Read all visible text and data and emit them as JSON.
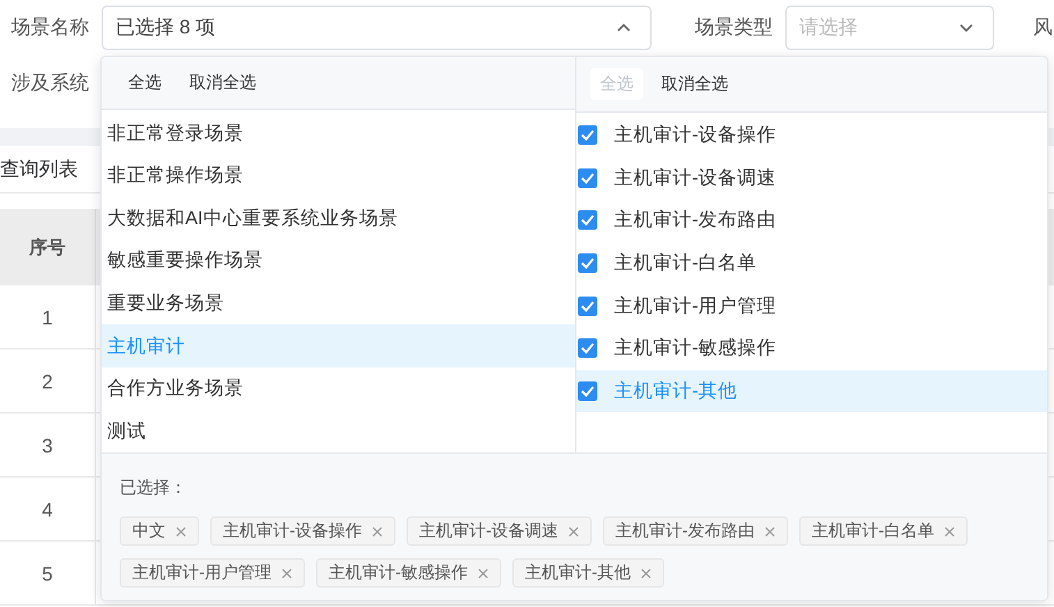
{
  "filters": [
    {
      "label": "场景名称",
      "value": "已选择 8 项",
      "expanded": true
    },
    {
      "label": "场景类型",
      "placeholder": "请选择",
      "expanded": false
    }
  ],
  "cut_label": "风",
  "filter_row2_label": "涉及系统",
  "section_title": "查询列表",
  "table": {
    "columns": [
      "序号"
    ],
    "rows": [
      "1",
      "2",
      "3",
      "4",
      "5"
    ]
  },
  "dropdown": {
    "left": {
      "actions": [
        {
          "label": "全选",
          "disabled": false
        },
        {
          "label": "取消全选",
          "disabled": false
        }
      ],
      "items": [
        {
          "label": "非正常登录场景",
          "selected": false
        },
        {
          "label": "非正常操作场景",
          "selected": false
        },
        {
          "label": "大数据和AI中心重要系统业务场景",
          "selected": false
        },
        {
          "label": "敏感重要操作场景",
          "selected": false
        },
        {
          "label": "重要业务场景",
          "selected": false
        },
        {
          "label": "主机审计",
          "selected": true
        },
        {
          "label": "合作方业务场景",
          "selected": false
        },
        {
          "label": "测试",
          "selected": false
        }
      ]
    },
    "right": {
      "actions": [
        {
          "label": "全选",
          "disabled": true
        },
        {
          "label": "取消全选",
          "disabled": false
        }
      ],
      "items": [
        {
          "label": "主机审计-设备操作",
          "checked": true,
          "selected": false
        },
        {
          "label": "主机审计-设备调速",
          "checked": true,
          "selected": false
        },
        {
          "label": "主机审计-发布路由",
          "checked": true,
          "selected": false
        },
        {
          "label": "主机审计-白名单",
          "checked": true,
          "selected": false
        },
        {
          "label": "主机审计-用户管理",
          "checked": true,
          "selected": false
        },
        {
          "label": "主机审计-敏感操作",
          "checked": true,
          "selected": false
        },
        {
          "label": "主机审计-其他",
          "checked": true,
          "selected": true
        }
      ]
    },
    "selected_label": "已选择：",
    "tags": [
      "中文",
      "主机审计-设备操作",
      "主机审计-设备调速",
      "主机审计-发布路由",
      "主机审计-白名单",
      "主机审计-用户管理",
      "主机审计-敏感操作",
      "主机审计-其他"
    ]
  }
}
